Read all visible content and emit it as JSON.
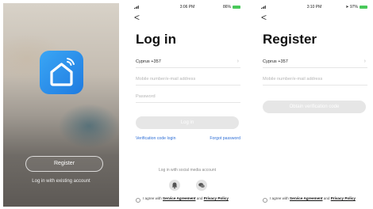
{
  "splash": {
    "register_label": "Register",
    "existing_account_label": "Log in with existing account",
    "app_icon": "smart-home-icon"
  },
  "login": {
    "status": {
      "time": "3:06 PM",
      "battery": "86%"
    },
    "back": "<",
    "title": "Log in",
    "country": "Cyprus +357",
    "account_placeholder": "Mobile number/e-mail address",
    "password_placeholder": "Password",
    "login_button": "Log in",
    "verification_login": "Verification code login",
    "forgot_password": "Forgot password",
    "social_label": "Log in with social media account",
    "social_icons": [
      "bell-icon",
      "chat-icon"
    ],
    "agree_prefix": "I agree with",
    "service_agreement": "Service Agreement",
    "agree_and": "and",
    "privacy_policy": "Privacy Policy"
  },
  "register": {
    "status": {
      "time": "3:10 PM",
      "battery": "97%"
    },
    "back": "<",
    "title": "Register",
    "country": "Cyprus +357",
    "account_placeholder": "Mobile number/e-mail address",
    "obtain_button": "Obtain verification code",
    "agree_prefix": "I agree with",
    "service_agreement": "Service Agreement",
    "agree_and": "and",
    "privacy_policy": "Privacy Policy"
  },
  "colors": {
    "brand_blue": "#1f7be0",
    "link_blue": "#2f6fd6",
    "battery_green": "#49c95a",
    "disabled_button": "#e6e6e6"
  }
}
